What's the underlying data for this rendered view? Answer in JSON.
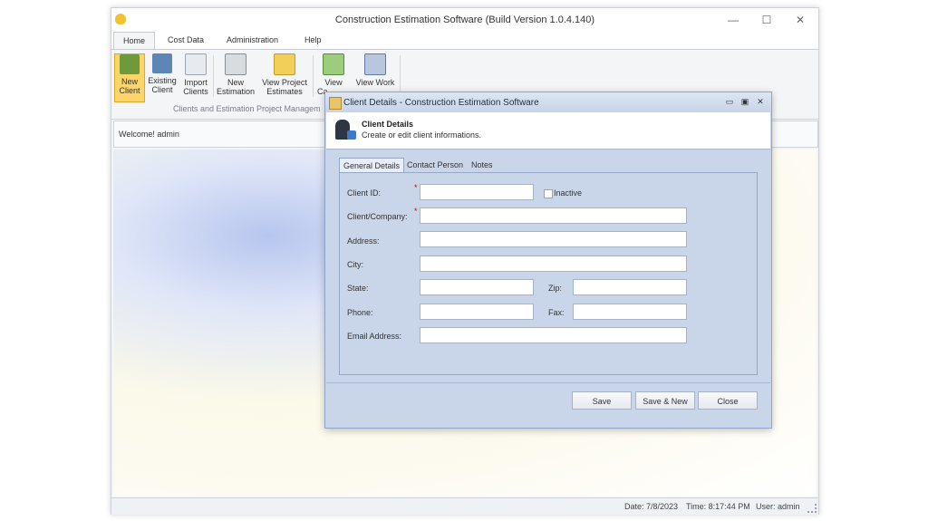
{
  "window": {
    "title": "Construction Estimation Software (Build Version 1.0.4.140)",
    "minimize": "—",
    "maximize": "☐",
    "close": "✕"
  },
  "ribbon_tabs": [
    "Home",
    "Cost Data",
    "Administration",
    "Help"
  ],
  "ribbon_buttons": {
    "new_client": [
      "New",
      "Client"
    ],
    "existing_client": [
      "Existing",
      "Client"
    ],
    "import_clients": [
      "Import",
      "Clients"
    ],
    "new_estimation": [
      "New",
      "Estimation"
    ],
    "view_project_estimates": [
      "View Project",
      "Estimates"
    ],
    "view_ca": [
      "View",
      "Ca"
    ],
    "view_work": [
      "View Work",
      ""
    ]
  },
  "ribbon_group_label": "Clients and Estimation Project Managem",
  "welcome": "Welcome! admin",
  "status": {
    "date": "Date: 7/8/2023",
    "time": "Time: 8:17:44 PM",
    "user": "User: admin"
  },
  "dialog": {
    "title": "Client Details - Construction Estimation Software",
    "header_title": "Client Details",
    "header_subtitle": "Create or edit client informations.",
    "tabs": [
      "General Details",
      "Contact Person",
      "Notes"
    ],
    "fields": {
      "client_id": {
        "label": "Client ID:",
        "value": ""
      },
      "inactive": "Inactive",
      "client_company": {
        "label": "Client/Company:",
        "value": ""
      },
      "address": {
        "label": "Address:",
        "value": ""
      },
      "city": {
        "label": "City:",
        "value": ""
      },
      "state": {
        "label": "State:",
        "value": ""
      },
      "zip": {
        "label": "Zip:",
        "value": ""
      },
      "phone": {
        "label": "Phone:",
        "value": ""
      },
      "fax": {
        "label": "Fax:",
        "value": ""
      },
      "email": {
        "label": "Email Address:",
        "value": ""
      }
    },
    "required_mark": "*",
    "buttons": {
      "save": "Save",
      "save_new": "Save & New",
      "close": "Close"
    }
  },
  "colors": {
    "accent": "#fbd46a",
    "dialog_bg": "#c9d6ea",
    "required": "#cc0000"
  }
}
